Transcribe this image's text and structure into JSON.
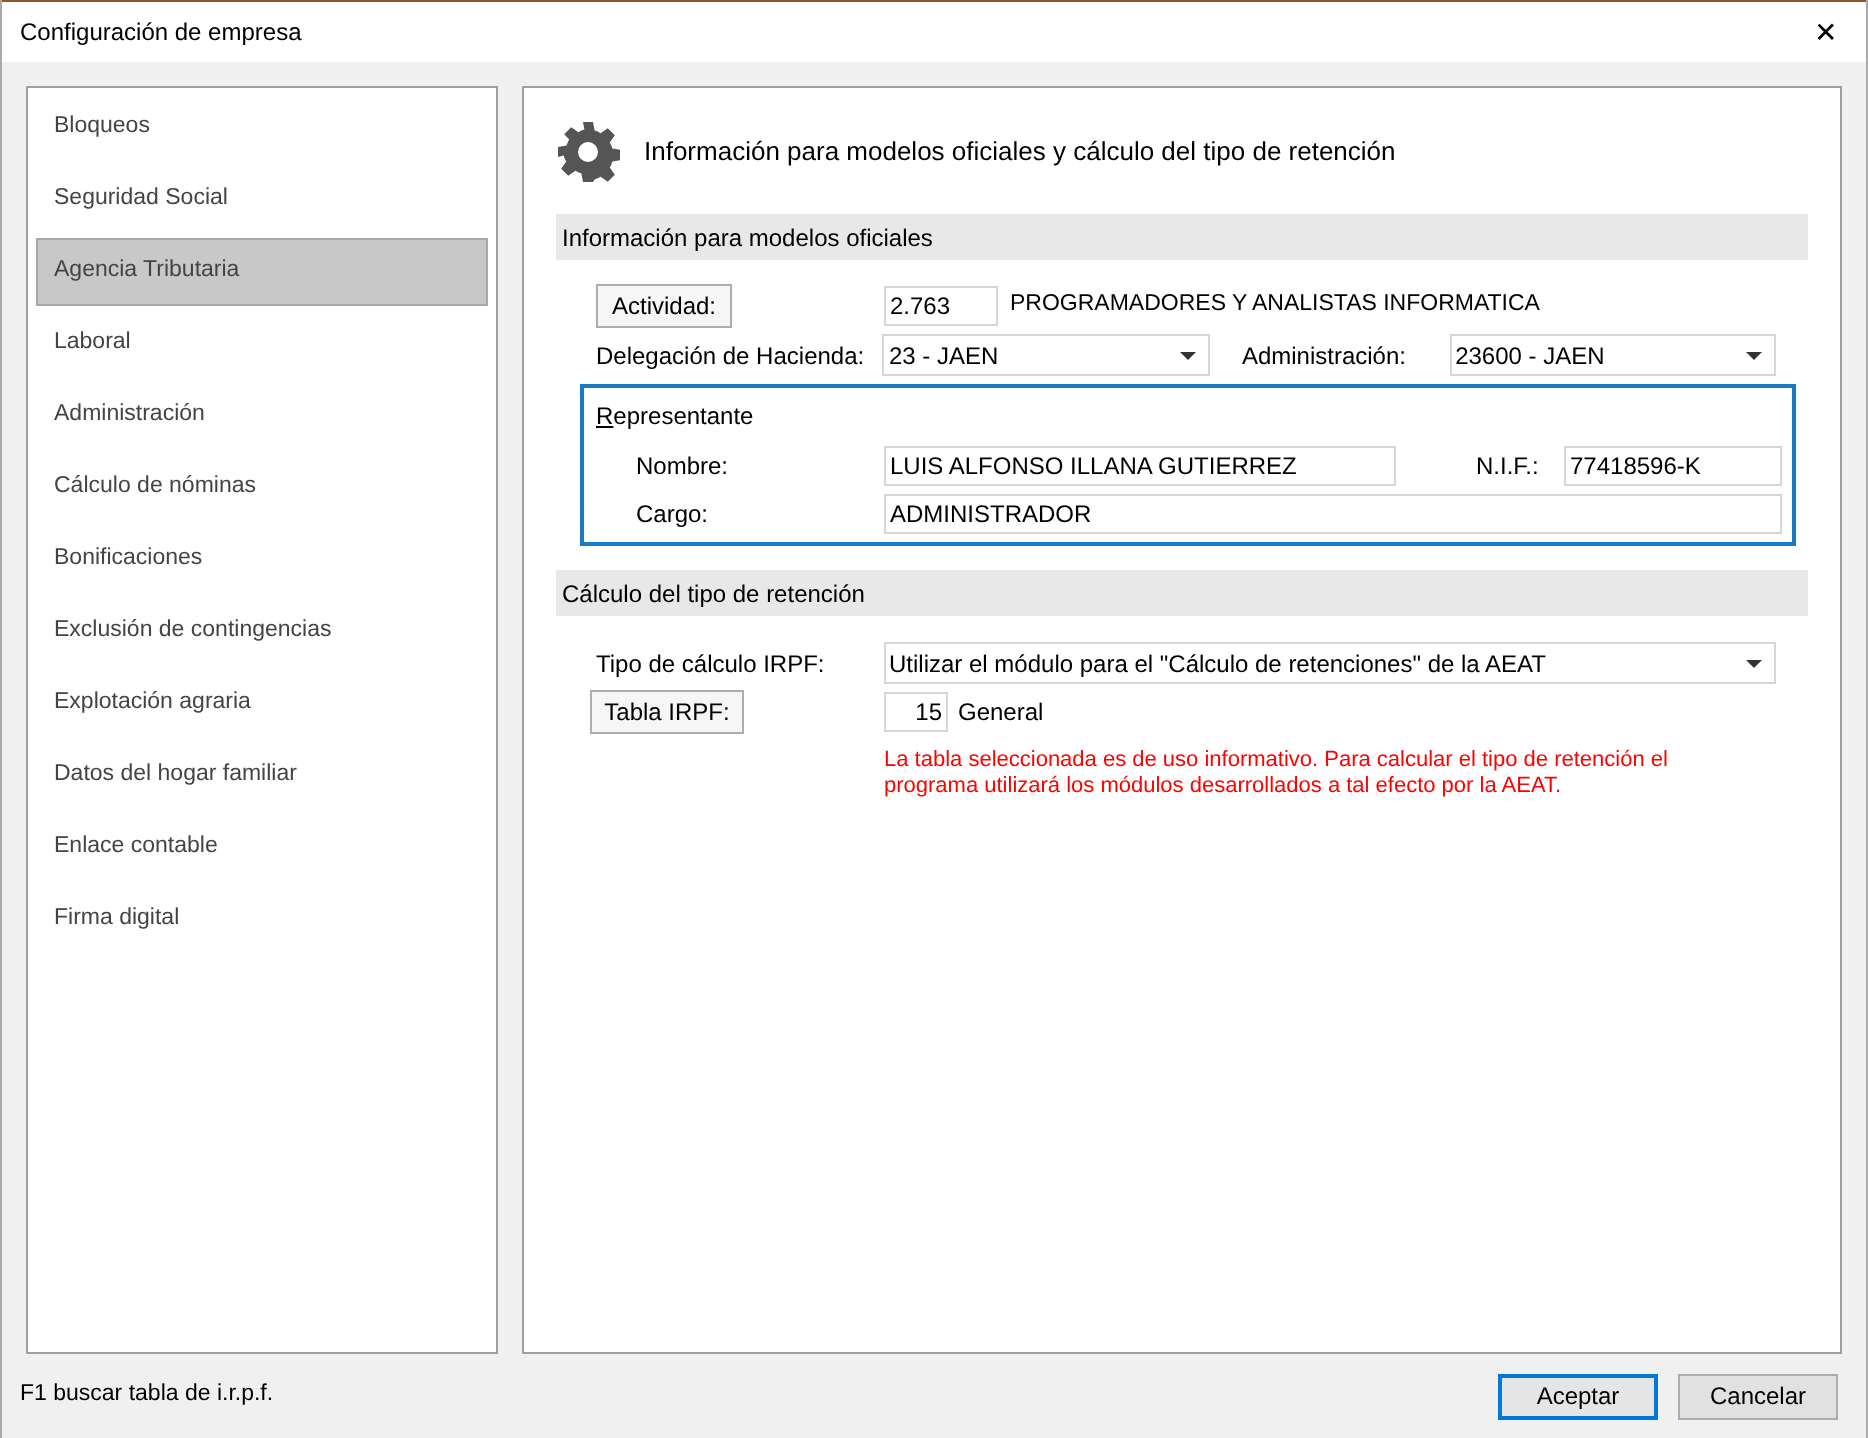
{
  "window": {
    "title": "Configuración de empresa",
    "close": "✕"
  },
  "sidebar": {
    "items": [
      {
        "label": "Bloqueos",
        "selected": false
      },
      {
        "label": "Seguridad Social",
        "selected": false
      },
      {
        "label": "Agencia Tributaria",
        "selected": true
      },
      {
        "label": "Laboral",
        "selected": false
      },
      {
        "label": "Administración",
        "selected": false
      },
      {
        "label": "Cálculo de nóminas",
        "selected": false
      },
      {
        "label": "Bonificaciones",
        "selected": false
      },
      {
        "label": "Exclusión de contingencias",
        "selected": false
      },
      {
        "label": "Explotación agraria",
        "selected": false
      },
      {
        "label": "Datos del hogar familiar",
        "selected": false
      },
      {
        "label": "Enlace contable",
        "selected": false
      },
      {
        "label": "Firma digital",
        "selected": false
      }
    ]
  },
  "header": {
    "title": "Información para modelos oficiales y cálculo del tipo de retención"
  },
  "section_1": {
    "title": "Información para modelos oficiales",
    "actividad": {
      "button": "Actividad:",
      "code": "2.763",
      "description": "PROGRAMADORES Y ANALISTAS INFORMATICA"
    },
    "delegacion": {
      "label": "Delegación de Hacienda:",
      "value": "23 - JAEN"
    },
    "administracion": {
      "label": "Administración:",
      "value": "23600 - JAEN"
    },
    "representante": {
      "title": "Representante",
      "nombre_label": "Nombre:",
      "nombre": "LUIS ALFONSO ILLANA GUTIERREZ",
      "nif_label": "N.I.F.:",
      "nif": "77418596-K",
      "cargo_label": "Cargo:",
      "cargo": "ADMINISTRADOR"
    }
  },
  "section_2": {
    "title": "Cálculo del tipo de retención",
    "tipo": {
      "label": "Tipo de cálculo IRPF:",
      "value": "Utilizar el módulo para el \"Cálculo de retenciones\" de la AEAT"
    },
    "tabla": {
      "button": "Tabla IRPF:",
      "value": "15",
      "description": "General"
    },
    "warning": "La tabla seleccionada es de uso informativo. Para calcular el tipo de retención el programa utilizará los módulos desarrollados a tal efecto por la AEAT."
  },
  "status": "F1 buscar tabla de i.r.p.f.",
  "buttons": [
    {
      "label": "Aceptar",
      "default": true
    },
    {
      "label": "Cancelar",
      "default": false
    }
  ]
}
